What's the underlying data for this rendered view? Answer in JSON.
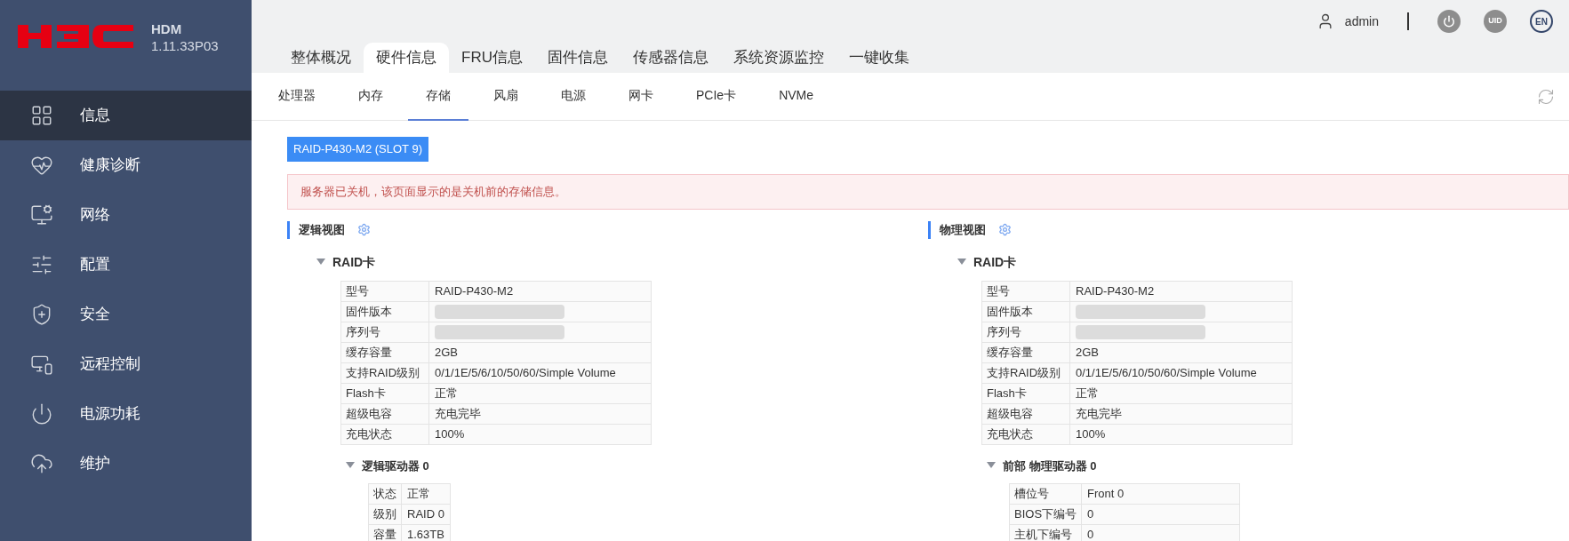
{
  "brand": {
    "product": "HDM",
    "version": "1.11.33P03"
  },
  "sidebar": {
    "items": [
      {
        "label": "信息",
        "selected": true
      },
      {
        "label": "健康诊断",
        "selected": false
      },
      {
        "label": "网络",
        "selected": false
      },
      {
        "label": "配置",
        "selected": false
      },
      {
        "label": "安全",
        "selected": false
      },
      {
        "label": "远程控制",
        "selected": false
      },
      {
        "label": "电源功耗",
        "selected": false
      },
      {
        "label": "维护",
        "selected": false
      }
    ]
  },
  "header": {
    "user": "admin",
    "buttons": [
      {
        "kind": "power"
      },
      {
        "kind": "uid",
        "label": "UID"
      },
      {
        "kind": "lang",
        "label": "EN"
      }
    ]
  },
  "tabs": [
    {
      "label": "整体概况",
      "selected": false
    },
    {
      "label": "硬件信息",
      "selected": true
    },
    {
      "label": "FRU信息",
      "selected": false
    },
    {
      "label": "固件信息",
      "selected": false
    },
    {
      "label": "传感器信息",
      "selected": false
    },
    {
      "label": "系统资源监控",
      "selected": false
    },
    {
      "label": "一键收集",
      "selected": false
    }
  ],
  "subtabs": [
    {
      "label": "处理器",
      "selected": false
    },
    {
      "label": "内存",
      "selected": false
    },
    {
      "label": "存储",
      "selected": true
    },
    {
      "label": "风扇",
      "selected": false
    },
    {
      "label": "电源",
      "selected": false
    },
    {
      "label": "网卡",
      "selected": false
    },
    {
      "label": "PCIe卡",
      "selected": false
    },
    {
      "label": "NVMe",
      "selected": false
    }
  ],
  "controller_chip": "RAID-P430-M2 (SLOT 9)",
  "alert": "服务器已关机，该页面显示的是关机前的存储信息。",
  "views": [
    {
      "title": "逻辑视图",
      "card": {
        "title": "RAID卡",
        "expanded": true,
        "rows": [
          {
            "label": "型号",
            "value": "RAID-P430-M2"
          },
          {
            "label": "固件版本",
            "redacted": true
          },
          {
            "label": "序列号",
            "redacted": true
          },
          {
            "label": "缓存容量",
            "value": "2GB"
          },
          {
            "label": "支持RAID级别",
            "value": "0/1/1E/5/6/10/50/60/Simple Volume"
          },
          {
            "label": "Flash卡",
            "value": "正常"
          },
          {
            "label": "超级电容",
            "value": "充电完毕"
          },
          {
            "label": "充电状态",
            "value": "100%"
          }
        ]
      },
      "sub": {
        "title": "逻辑驱动器 0",
        "expanded": true,
        "rows": [
          {
            "label": "状态",
            "value": "正常"
          },
          {
            "label": "级别",
            "value": "RAID 0"
          },
          {
            "label": "容量",
            "value": "1.63TB"
          }
        ]
      }
    },
    {
      "title": "物理视图",
      "card": {
        "title": "RAID卡",
        "expanded": true,
        "rows": [
          {
            "label": "型号",
            "value": "RAID-P430-M2"
          },
          {
            "label": "固件版本",
            "redacted": true
          },
          {
            "label": "序列号",
            "redacted": true
          },
          {
            "label": "缓存容量",
            "value": "2GB"
          },
          {
            "label": "支持RAID级别",
            "value": "0/1/1E/5/6/10/50/60/Simple Volume"
          },
          {
            "label": "Flash卡",
            "value": "正常"
          },
          {
            "label": "超级电容",
            "value": "充电完毕"
          },
          {
            "label": "充电状态",
            "value": "100%"
          }
        ]
      },
      "sub": {
        "title": "前部 物理驱动器 0",
        "expanded": true,
        "rows": [
          {
            "label": "槽位号",
            "value": "Front 0"
          },
          {
            "label": "BIOS下编号",
            "value": "0"
          },
          {
            "label": "主机下编号",
            "value": "0"
          }
        ]
      }
    }
  ]
}
